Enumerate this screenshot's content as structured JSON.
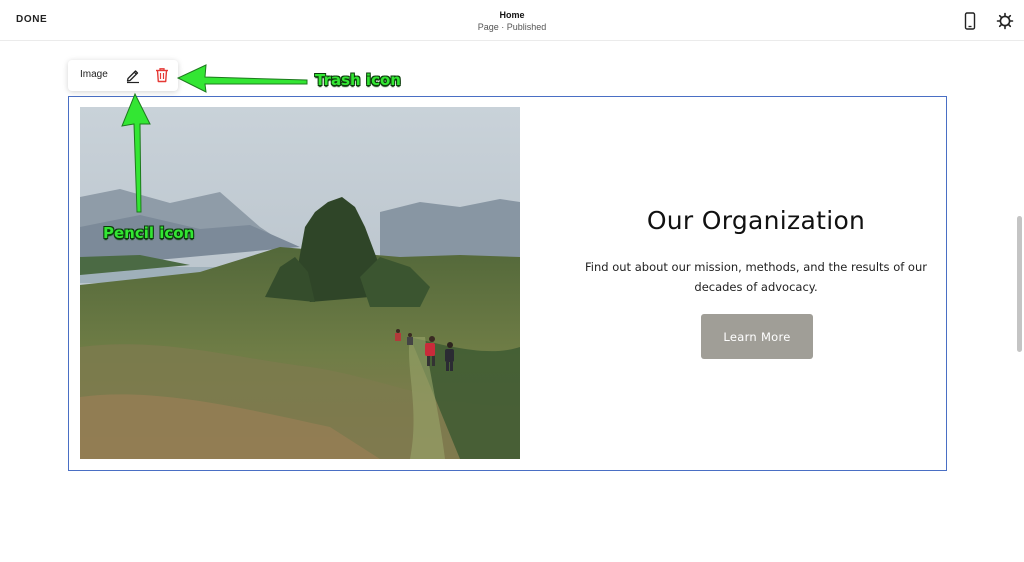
{
  "header": {
    "done_label": "DONE",
    "page_title": "Home",
    "page_status": "Page · Published",
    "mobile_icon": "mobile-phone-icon",
    "settings_icon": "gear-icon"
  },
  "block_toolbar": {
    "label": "Image",
    "edit_icon": "pencil-icon",
    "delete_icon": "trash-icon",
    "delete_color": "#e53935"
  },
  "section": {
    "border_color": "#4a6fc4",
    "image_alt": "Hikers walking along a grassy trail with mountains and trees",
    "title": "Our Organization",
    "description": "Find out about our mission, methods, and the results of our decades of advocacy.",
    "button_label": "Learn More",
    "button_color": "#a09e97"
  },
  "annotations": {
    "trash_label": "Trash icon",
    "pencil_label": "Pencil icon",
    "arrow_color": "#33e633"
  }
}
